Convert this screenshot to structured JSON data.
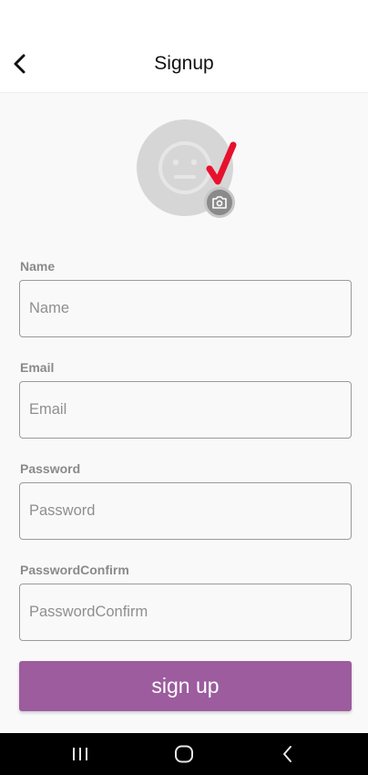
{
  "header": {
    "title": "Signup",
    "back_icon": "chevron-left-icon"
  },
  "avatar": {
    "placeholder_icon": "neutral-face-icon",
    "checkmark_icon": "red-checkmark-icon",
    "camera_icon": "camera-icon"
  },
  "form": {
    "name_label": "Name",
    "name_placeholder": "Name",
    "email_label": "Email",
    "email_placeholder": "Email",
    "password_label": "Password",
    "password_placeholder": "Password",
    "password_confirm_label": "PasswordConfirm",
    "password_confirm_placeholder": "PasswordConfirm",
    "submit_label": "sign up"
  },
  "navbar": {
    "recents_icon": "recents-icon",
    "home_icon": "home-icon",
    "back_icon": "back-icon"
  },
  "colors": {
    "accent": "#9c5c9e",
    "check": "#e8112d",
    "label": "#8a8a8a"
  }
}
